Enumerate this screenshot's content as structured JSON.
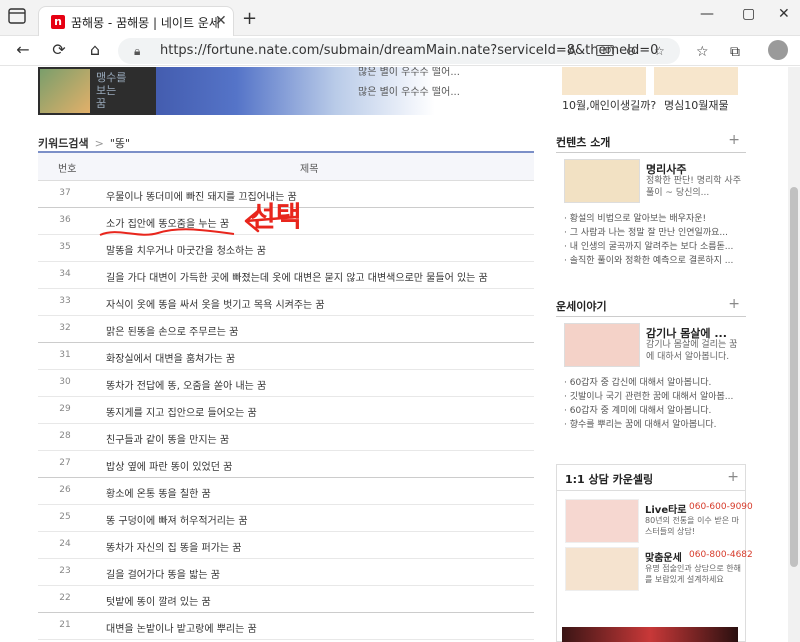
{
  "browser": {
    "tab_title": "꿈해몽 - 꿈해몽 | 네이트 운세",
    "tab_favicon": "n",
    "url": "https://fortune.nate.com/submain/dreamMain.nate?serviceId=8&themeId=0"
  },
  "banner": {
    "caption": "맹수를\n보는\n꿈",
    "items": [
      "많은 별이 우수수 떨어...",
      "많은 별이 우수수 떨어..."
    ],
    "right_captions": [
      "10월,애인이생길까?",
      "명심10월재물"
    ]
  },
  "breadcrumb": {
    "label": "키워드검색",
    "keyword": "\"똥\""
  },
  "table": {
    "col_num": "번호",
    "col_title": "제목",
    "rows": [
      {
        "num": "37",
        "title": "우물이나 똥더미에 빠진 돼지를 끄집어내는 꿈"
      },
      {
        "num": "36",
        "title": "소가 집안에 똥오줌을 누는 꿈"
      },
      {
        "num": "35",
        "title": "말똥을 치우거나 마굿간을 청소하는 꿈"
      },
      {
        "num": "34",
        "title": "길을 가다 대변이 가득한 곳에 빠졌는데 옷에 대변은 묻지 않고 대변색으로만 물들어 있는 꿈"
      },
      {
        "num": "33",
        "title": "자식이 옷에 똥을 싸서 옷을 벗기고 목욕 시켜주는 꿈"
      },
      {
        "num": "32",
        "title": "맑은 된똥을 손으로 주무르는 꿈"
      },
      {
        "num": "31",
        "title": "화장실에서 대변을 훔쳐가는 꿈"
      },
      {
        "num": "30",
        "title": "똥차가 전답에 똥, 오줌을 쏟아 내는 꿈"
      },
      {
        "num": "29",
        "title": "똥지게를 지고 집안으로 들어오는 꿈"
      },
      {
        "num": "28",
        "title": "친구들과 같이 똥을 만지는 꿈"
      },
      {
        "num": "27",
        "title": "밥상 옆에 파란 똥이 있었던 꿈"
      },
      {
        "num": "26",
        "title": "황소에 온통 똥을 칠한 꿈"
      },
      {
        "num": "25",
        "title": "똥 구덩이에 빠져 허우적거리는 꿈"
      },
      {
        "num": "24",
        "title": "똥차가 자신의 집 똥을 퍼가는 꿈"
      },
      {
        "num": "23",
        "title": "길을 걸어가다 똥을 밟는 꿈"
      },
      {
        "num": "22",
        "title": "텃밭에 똥이 깔려 있는 꿈"
      },
      {
        "num": "21",
        "title": "대변을 논밭이나 밭고랑에 뿌리는 꿈"
      }
    ]
  },
  "annotation": {
    "text": "선택"
  },
  "sidebar": {
    "contents": {
      "title": "컨텐츠 소개",
      "plus": "+",
      "profile_name": "명리사주",
      "profile_desc": "정확한 판단! 명리학 사주 풀이 ~ 당신의...",
      "items": [
        "황설의 비법으로 알아보는 배우자운!",
        "그 사람과 나는 정말 잘 만난 인연일까요...",
        "내 인생의 굴곡까지 알려주는 보다 소름돋...",
        "솔직한 풀이와 정확한 예측으로 결론하지 ..."
      ]
    },
    "fortune": {
      "title": "운세이야기",
      "plus": "+",
      "profile_name": "감기나 몸살에 ...",
      "profile_desc": "감기나 몸살에 걸리는 꿈에 대하서 알아봅니다.",
      "items": [
        "60갑자 중 갑신에 대해서 알아봅니다.",
        "깃발이나 국기 관련한 꿈에 대해서 알아봅...",
        "60갑자 중 계미에 대해서 알아봅니다.",
        "향수를 뿌리는 꿈에 대해서 알아봅니다."
      ]
    },
    "counsel": {
      "title": "1:1 상담 카운셀링",
      "plus": "+",
      "items": [
        {
          "name": "Live타로",
          "phone": "060-600-9090",
          "desc": "80년의 전통을 이수 받은 마스터들의 상담!"
        },
        {
          "name": "맞춤운세",
          "phone": "060-800-4682",
          "desc": "유명 점술인과 상담으로 한해를 보람있게 설계하세요"
        }
      ]
    }
  }
}
